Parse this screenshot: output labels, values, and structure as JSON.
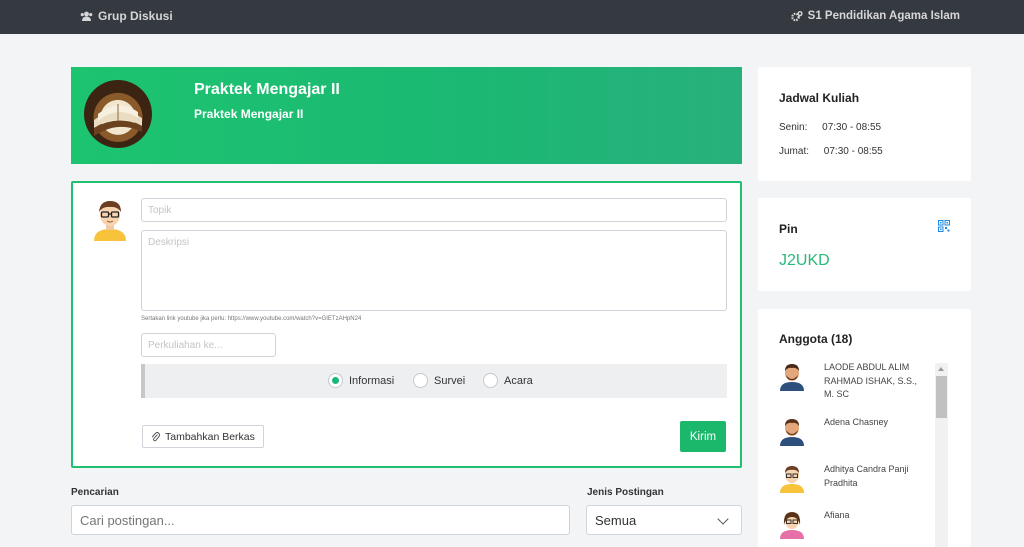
{
  "topbar": {
    "group_label": "Grup Diskusi",
    "group_icon": "users-icon",
    "program_label": "S1 Pendidikan Agama Islam",
    "program_icon": "cogs-icon"
  },
  "course": {
    "title": "Praktek Mengajar II",
    "subtitle": "Praktek Mengajar II",
    "image_icon": "book-image"
  },
  "post_form": {
    "topic_placeholder": "Topik",
    "description_placeholder": "Deskripsi",
    "youtube_hint": "Sertakan link youtube jika perlu: https://www.youtube.com/watch?v=GIETzAHpN24",
    "session_placeholder": "Perkuliahan ke...",
    "post_types": [
      {
        "label": "Informasi",
        "selected": true
      },
      {
        "label": "Survei",
        "selected": false
      },
      {
        "label": "Acara",
        "selected": false
      }
    ],
    "attach_label": "Tambahkan Berkas",
    "submit_label": "Kirim"
  },
  "filter": {
    "search_label": "Pencarian",
    "search_placeholder": "Cari postingan...",
    "type_label": "Jenis Postingan",
    "type_selected": "Semua"
  },
  "schedule": {
    "title": "Jadwal Kuliah",
    "rows": [
      {
        "day": "Senin:",
        "time": "07:30 - 08:55"
      },
      {
        "day": "Jumat:",
        "time": "07:30 - 08:55"
      }
    ]
  },
  "pin": {
    "title": "Pin",
    "code": "J2UKD",
    "qr_icon": "qr-code-icon"
  },
  "members": {
    "title": "Anggota (18)",
    "list": [
      {
        "name": "LAODE ABDUL ALIM RAHMAD ISHAK, S.S., M. SC"
      },
      {
        "name": "Adena Chasney"
      },
      {
        "name": "Adhitya Candra Panji Pradhita"
      },
      {
        "name": "Afiana"
      }
    ]
  },
  "colors": {
    "accent": "#1bb86b",
    "topbar": "#343a40",
    "pin_code": "#2cb87a"
  }
}
